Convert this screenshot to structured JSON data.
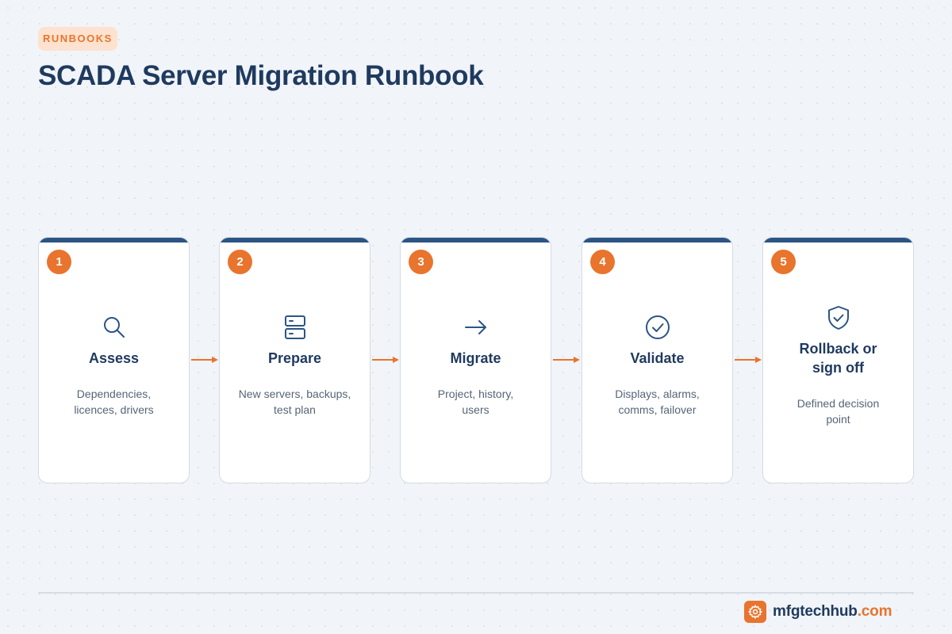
{
  "header": {
    "badge": "RUNBOOKS",
    "title": "SCADA Server Migration Runbook"
  },
  "steps": [
    {
      "number": "1",
      "icon": "search-icon",
      "title_line1": "Assess",
      "title_line2": "",
      "desc_line1": "Dependencies,",
      "desc_line2": "licences, drivers"
    },
    {
      "number": "2",
      "icon": "server-icon",
      "title_line1": "Prepare",
      "title_line2": "",
      "desc_line1": "New servers, backups,",
      "desc_line2": "test plan"
    },
    {
      "number": "3",
      "icon": "arrow-right-icon",
      "title_line1": "Migrate",
      "title_line2": "",
      "desc_line1": "Project, history,",
      "desc_line2": "users"
    },
    {
      "number": "4",
      "icon": "check-circle-icon",
      "title_line1": "Validate",
      "title_line2": "",
      "desc_line1": "Displays, alarms,",
      "desc_line2": "comms, failover"
    },
    {
      "number": "5",
      "icon": "shield-check-icon",
      "title_line1": "Rollback or",
      "title_line2": "sign off",
      "desc_line1": "Defined decision",
      "desc_line2": "point"
    }
  ],
  "footer": {
    "brand_name": "mfgtechhub",
    "brand_tld": ".com",
    "logo_icon": "gear-icon"
  },
  "colors": {
    "accent": "#e8742e",
    "navy": "#1f3a5f",
    "card_bar": "#2c5584",
    "background": "#f1f4f8"
  }
}
